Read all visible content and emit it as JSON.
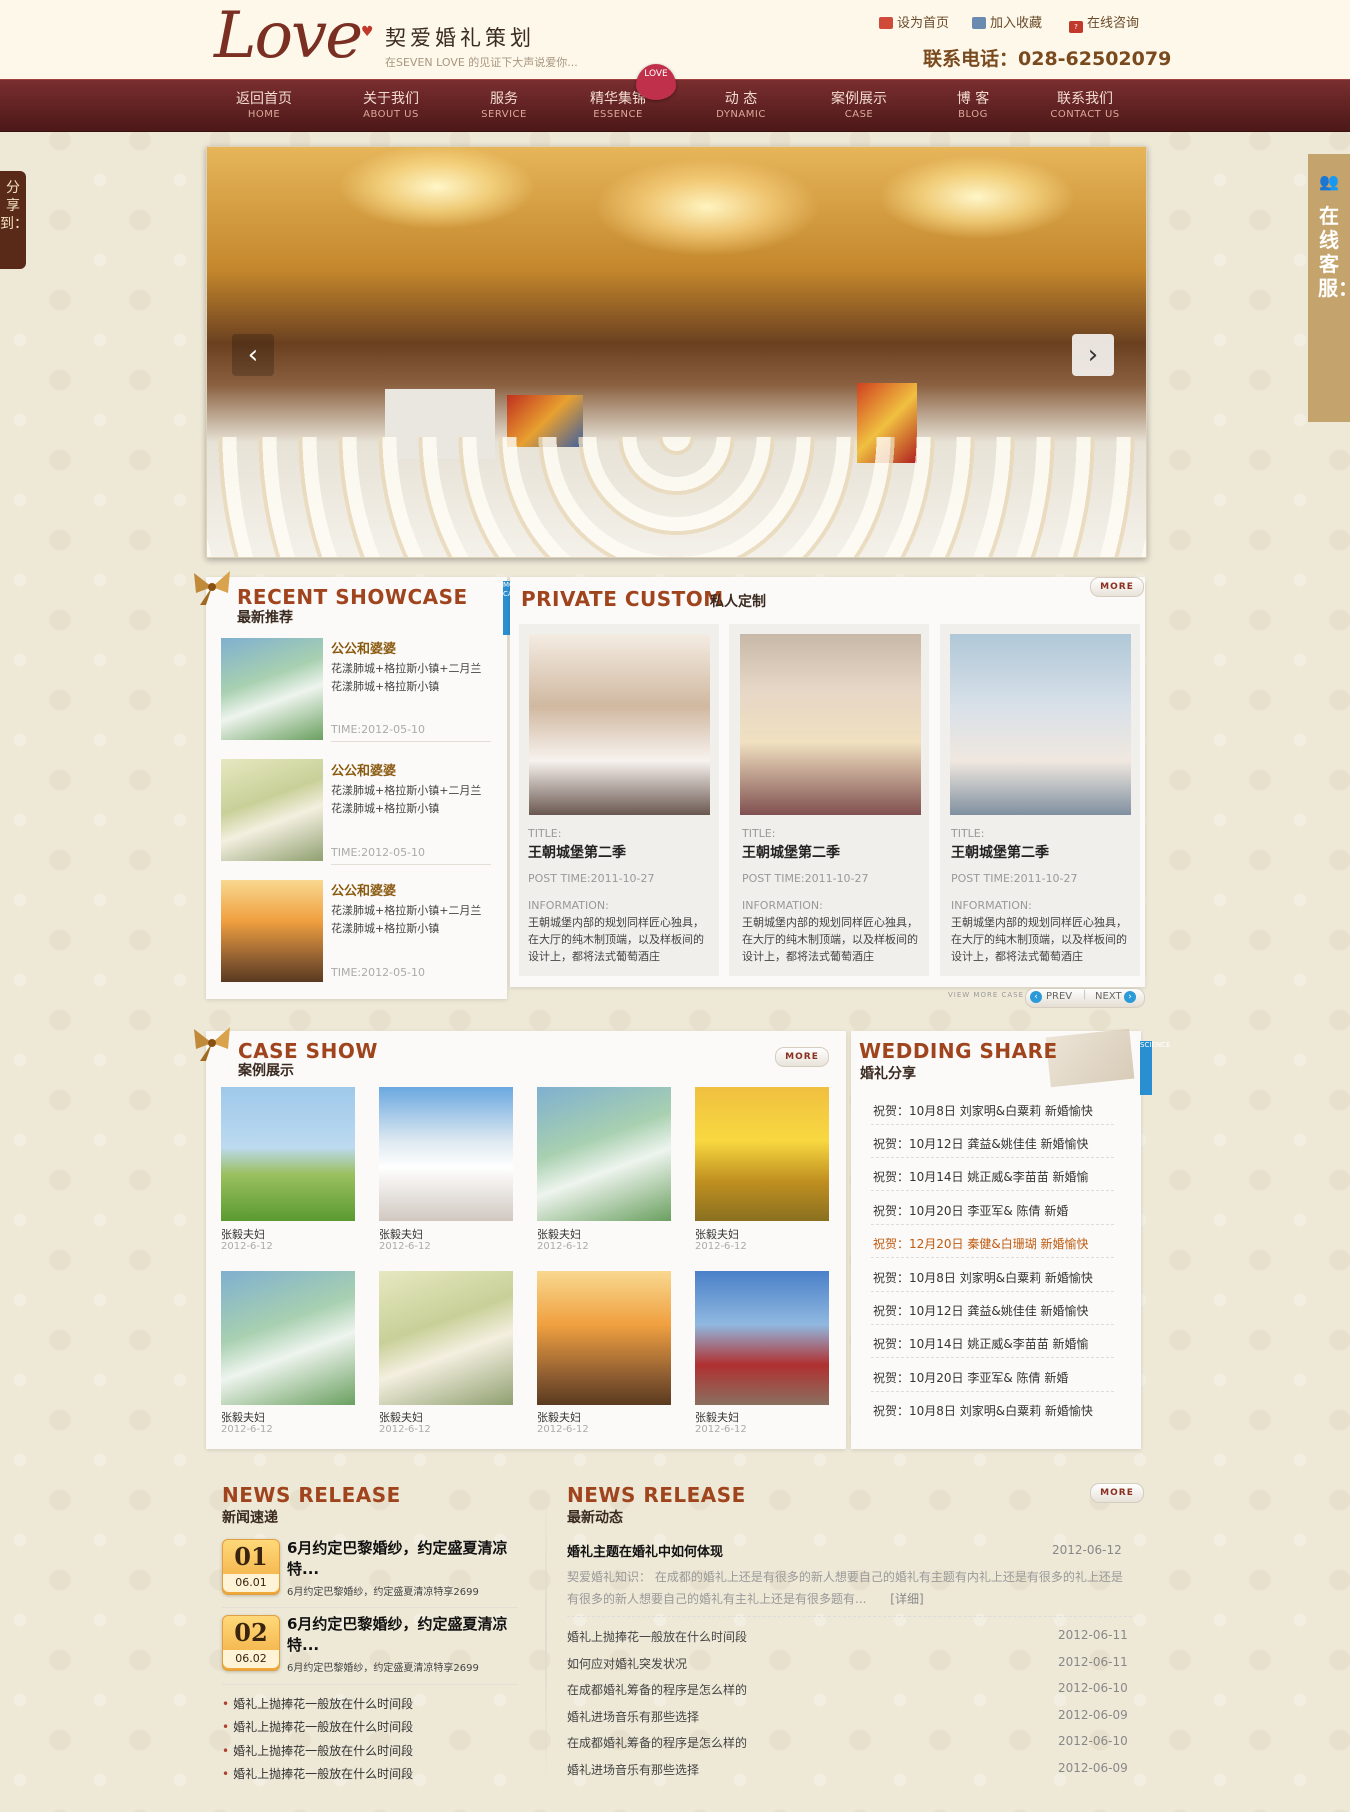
{
  "header": {
    "logo_script": "Love",
    "logo_cn": "契爱婚礼策划",
    "slogan": "在SEVEN LOVE 的见证下大声说爱你...",
    "links": [
      "设为首页",
      "加入收藏",
      "在线咨询"
    ],
    "phone": "联系电话：028-62502079"
  },
  "nav": {
    "badge": "LOVE",
    "items": [
      {
        "cn": "返回首页",
        "en": "HOME"
      },
      {
        "cn": "关于我们",
        "en": "ABOUT US"
      },
      {
        "cn": "服务",
        "en": "SERVICE"
      },
      {
        "cn": "精华集锦",
        "en": "ESSENCE"
      },
      {
        "cn": "动 态",
        "en": "DYNAMIC"
      },
      {
        "cn": "案例展示",
        "en": "CASE"
      },
      {
        "cn": "博 客",
        "en": "BLOG"
      },
      {
        "cn": "联系我们",
        "en": "CONTACT US"
      }
    ]
  },
  "side": {
    "share": "分享到：",
    "service": "在线客服："
  },
  "banner": {
    "prev": "‹",
    "next": "›"
  },
  "recent_showcase": {
    "title_en": "RECENT SHOWCASE",
    "title_cn": "最新推荐",
    "tab": "MORE CASE",
    "items": [
      {
        "title": "公公和婆婆",
        "line1": "花漾肺城+格拉斯小镇+二月兰",
        "line2": "花漾肺城+格拉斯小镇",
        "time": "TIME:2012-05-10"
      },
      {
        "title": "公公和婆婆",
        "line1": "花漾肺城+格拉斯小镇+二月兰",
        "line2": "花漾肺城+格拉斯小镇",
        "time": "TIME:2012-05-10"
      },
      {
        "title": "公公和婆婆",
        "line1": "花漾肺城+格拉斯小镇+二月兰",
        "line2": "花漾肺城+格拉斯小镇",
        "time": "TIME:2012-05-10"
      }
    ]
  },
  "private_custom": {
    "title_en": "PRIVATE CUSTOM",
    "title_cn": "私人定制",
    "more": "MORE",
    "view_more": "VIEW MORE CASE",
    "prev": "PREV",
    "next": "NEXT",
    "cards": [
      {
        "title_lbl": "TITLE:",
        "title": "王朝城堡第二季",
        "post": "POST TIME:2011-10-27",
        "info_lbl": "INFORMATION:",
        "info": "王朝城堡内部的规划同样匠心独具，在大厅的纯木制顶端，以及样板间的设计上，都将法式葡萄酒庄"
      },
      {
        "title_lbl": "TITLE:",
        "title": "王朝城堡第二季",
        "post": "POST TIME:2011-10-27",
        "info_lbl": "INFORMATION:",
        "info": "王朝城堡内部的规划同样匠心独具，在大厅的纯木制顶端，以及样板间的设计上，都将法式葡萄酒庄"
      },
      {
        "title_lbl": "TITLE:",
        "title": "王朝城堡第二季",
        "post": "POST TIME:2011-10-27",
        "info_lbl": "INFORMATION:",
        "info": "王朝城堡内部的规划同样匠心独具，在大厅的纯木制顶端，以及样板间的设计上，都将法式葡萄酒庄"
      }
    ]
  },
  "case_show": {
    "title_en": "CASE SHOW",
    "title_cn": "案例展示",
    "more": "MORE",
    "items": [
      {
        "name": "张毅夫妇",
        "date": "2012-6-12"
      },
      {
        "name": "张毅夫妇",
        "date": "2012-6-12"
      },
      {
        "name": "张毅夫妇",
        "date": "2012-6-12"
      },
      {
        "name": "张毅夫妇",
        "date": "2012-6-12"
      },
      {
        "name": "张毅夫妇",
        "date": "2012-6-12"
      },
      {
        "name": "张毅夫妇",
        "date": "2012-6-12"
      },
      {
        "name": "张毅夫妇",
        "date": "2012-6-12"
      },
      {
        "name": "张毅夫妇",
        "date": "2012-6-12"
      }
    ]
  },
  "wedding_share": {
    "title_en": "WEDDING SHARE",
    "title_cn": "婚礼分享",
    "tab": "SCIENCE",
    "items": [
      "祝贺：10月8日  刘家明&白粟莉  新婚愉快",
      "祝贺：10月12日  龚益&姚佳佳  新婚愉快",
      "祝贺：10月14日  姚正威&李苗苗  新婚愉",
      "祝贺：10月20日  李亚军& 陈倩  新婚",
      "祝贺：12月20日  秦健&白珊瑚  新婚愉快",
      "祝贺：10月8日  刘家明&白粟莉  新婚愉快",
      "祝贺：10月12日  龚益&姚佳佳  新婚愉快",
      "祝贺：10月14日  姚正威&李苗苗  新婚愉",
      "祝贺：10月20日  李亚军& 陈倩  新婚",
      "祝贺：10月8日  刘家明&白粟莉  新婚愉快"
    ]
  },
  "news_release": {
    "title_en": "NEWS RELEASE",
    "title_cn": "新闻速递",
    "features": [
      {
        "num": "01",
        "date": "06.01",
        "title": "6月约定巴黎婚纱，约定盛夏清凉特...",
        "desc": "6月约定巴黎婚纱，约定盛夏清凉特享2699"
      },
      {
        "num": "02",
        "date": "06.02",
        "title": "6月约定巴黎婚纱，约定盛夏清凉特...",
        "desc": "6月约定巴黎婚纱，约定盛夏清凉特享2699"
      }
    ],
    "list": [
      "婚礼上抛捧花一般放在什么时间段",
      "婚礼上抛捧花一般放在什么时间段",
      "婚礼上抛捧花一般放在什么时间段",
      "婚礼上抛捧花一般放在什么时间段"
    ]
  },
  "news_dynamic": {
    "title_en": "NEWS RELEASE",
    "title_cn": "最新动态",
    "more": "MORE",
    "lead_title": "婚礼主题在婚礼中如何体现",
    "lead_date": "2012-06-12",
    "lead_body": "契爱婚礼知识：  在成都的婚礼上还是有很多的新人想要自己的婚礼有主题有内礼上还是有很多的礼上还是有很多的新人想要自己的婚礼有主礼上还是有很多题有...",
    "lead_detail": "[详细]",
    "list": [
      {
        "t": "婚礼上抛捧花一般放在什么时间段",
        "d": "2012-06-11"
      },
      {
        "t": "如何应对婚礼突发状况",
        "d": "2012-06-11"
      },
      {
        "t": "在成都婚礼筹备的程序是怎么样的",
        "d": "2012-06-10"
      },
      {
        "t": "婚礼进场音乐有那些选择",
        "d": "2012-06-09"
      },
      {
        "t": "在成都婚礼筹备的程序是怎么样的",
        "d": "2012-06-10"
      },
      {
        "t": "婚礼进场音乐有那些选择",
        "d": "2012-06-09"
      }
    ]
  }
}
